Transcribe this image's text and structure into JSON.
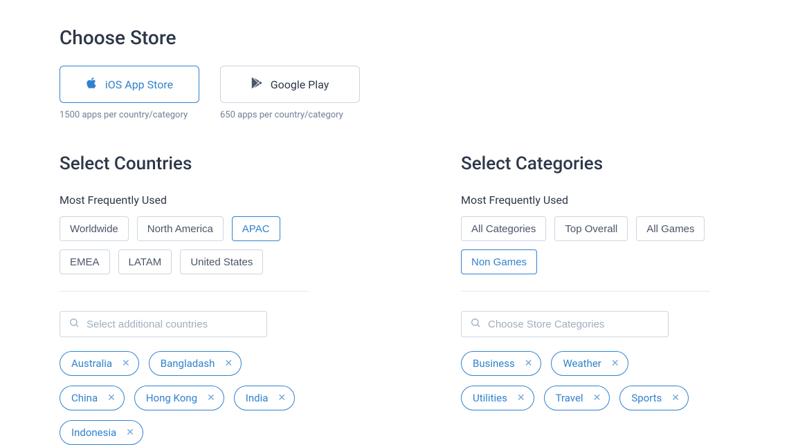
{
  "header": {
    "title": "Choose Store"
  },
  "stores": {
    "ios": {
      "label": "iOS App Store",
      "sub": "1500 apps per country/category"
    },
    "gplay": {
      "label": "Google Play",
      "sub": "650 apps per country/category"
    }
  },
  "countries": {
    "heading": "Select Countries",
    "subhead": "Most Frequently Used",
    "frequent": {
      "0": "Worldwide",
      "1": "North America",
      "2": "APAC",
      "3": "EMEA",
      "4": "LATAM",
      "5": "United States"
    },
    "search_placeholder": "Select additional countries",
    "selected": {
      "0": "Australia",
      "1": "Bangladash",
      "2": "China",
      "3": "Hong Kong",
      "4": "India",
      "5": "Indonesia"
    }
  },
  "categories": {
    "heading": "Select Categories",
    "subhead": "Most Frequently Used",
    "frequent": {
      "0": "All Categories",
      "1": "Top Overall",
      "2": "All Games",
      "3": "Non Games"
    },
    "search_placeholder": "Choose Store Categories",
    "selected": {
      "0": "Business",
      "1": "Weather",
      "2": "Utilities",
      "3": "Travel",
      "4": "Sports"
    }
  }
}
